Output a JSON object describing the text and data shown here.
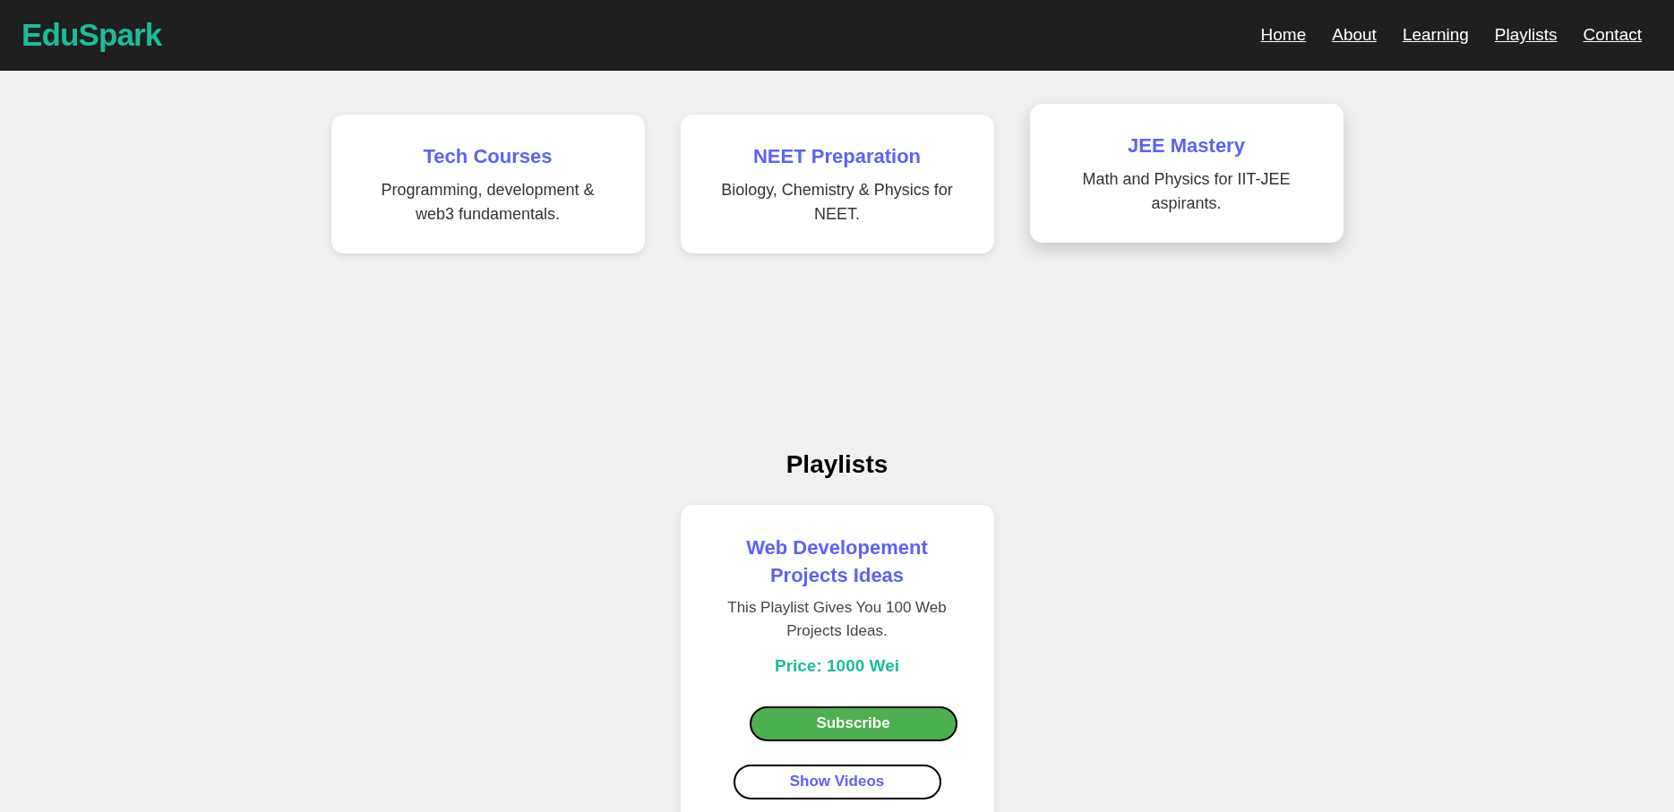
{
  "header": {
    "logo": "EduSpark",
    "nav": [
      {
        "label": "Home"
      },
      {
        "label": "About"
      },
      {
        "label": "Learning"
      },
      {
        "label": "Playlists"
      },
      {
        "label": "Contact"
      }
    ]
  },
  "courses": [
    {
      "title": "Tech Courses",
      "description": "Programming, development & web3 fundamentals.",
      "hovered": false
    },
    {
      "title": "NEET Preparation",
      "description": "Biology, Chemistry & Physics for NEET.",
      "hovered": false
    },
    {
      "title": "JEE Mastery",
      "description": "Math and Physics for IIT-JEE aspirants.",
      "hovered": true
    }
  ],
  "playlists_heading": "Playlists",
  "playlists": [
    {
      "title": "Web Developement Projects Ideas",
      "description": "This Playlist Gives You 100 Web Projects Ideas.",
      "price": "Price: 1000 Wei",
      "subscribe": "Subscribe",
      "show_videos": "Show Videos"
    }
  ]
}
